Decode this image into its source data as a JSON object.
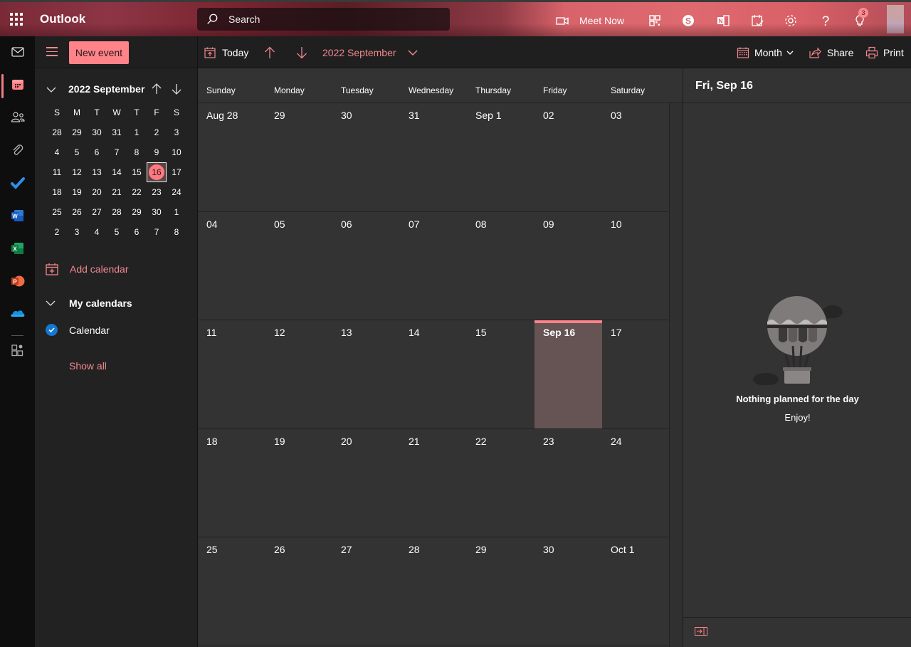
{
  "header": {
    "app_name": "Outlook",
    "search_placeholder": "Search",
    "meet_now_label": "Meet Now",
    "notification_count": "3",
    "icons": [
      "waffle-icon",
      "search-icon",
      "video-camera-icon",
      "qr-code-icon",
      "skype-icon",
      "onenote-icon",
      "todo-calendar-icon",
      "gear-icon",
      "help-icon",
      "lightbulb-icon"
    ]
  },
  "rail": {
    "items": [
      "mail",
      "calendar",
      "people",
      "files",
      "todo",
      "word",
      "excel",
      "powerpoint",
      "onedrive",
      "more-apps"
    ],
    "active": "calendar"
  },
  "left_pane": {
    "new_event_label": "New event",
    "mini_calendar": {
      "title": "2022 September",
      "weekdays": [
        "S",
        "M",
        "T",
        "W",
        "T",
        "F",
        "S"
      ],
      "weeks": [
        [
          "28",
          "29",
          "30",
          "31",
          "1",
          "2",
          "3"
        ],
        [
          "4",
          "5",
          "6",
          "7",
          "8",
          "9",
          "10"
        ],
        [
          "11",
          "12",
          "13",
          "14",
          "15",
          "16",
          "17"
        ],
        [
          "18",
          "19",
          "20",
          "21",
          "22",
          "23",
          "24"
        ],
        [
          "25",
          "26",
          "27",
          "28",
          "29",
          "30",
          "1"
        ],
        [
          "2",
          "3",
          "4",
          "5",
          "6",
          "7",
          "8"
        ]
      ],
      "selected": "16"
    },
    "add_calendar_label": "Add calendar",
    "my_calendars_label": "My calendars",
    "calendars": [
      {
        "name": "Calendar",
        "checked": true,
        "color": "#1477d4"
      }
    ],
    "show_all_label": "Show all"
  },
  "toolbar": {
    "today_label": "Today",
    "month_title": "2022 September",
    "view_label": "Month",
    "share_label": "Share",
    "print_label": "Print"
  },
  "calendar": {
    "weekdays": [
      "Sunday",
      "Monday",
      "Tuesday",
      "Wednesday",
      "Thursday",
      "Friday",
      "Saturday"
    ],
    "weeks": [
      [
        "Aug 28",
        "29",
        "30",
        "31",
        "Sep 1",
        "02",
        "03"
      ],
      [
        "04",
        "05",
        "06",
        "07",
        "08",
        "09",
        "10"
      ],
      [
        "11",
        "12",
        "13",
        "14",
        "15",
        "Sep 16",
        "17"
      ],
      [
        "18",
        "19",
        "20",
        "21",
        "22",
        "23",
        "24"
      ],
      [
        "25",
        "26",
        "27",
        "28",
        "29",
        "30",
        "Oct 1"
      ]
    ],
    "today": {
      "week": 2,
      "day": 5
    }
  },
  "right_pane": {
    "title": "Fri, Sep 16",
    "empty_title": "Nothing planned for the day",
    "empty_subtitle": "Enjoy!"
  },
  "colors": {
    "accent": "#ff8389",
    "accent_text": "#f0878d",
    "today_cell": "#665354",
    "calendar_check": "#1477d4"
  }
}
